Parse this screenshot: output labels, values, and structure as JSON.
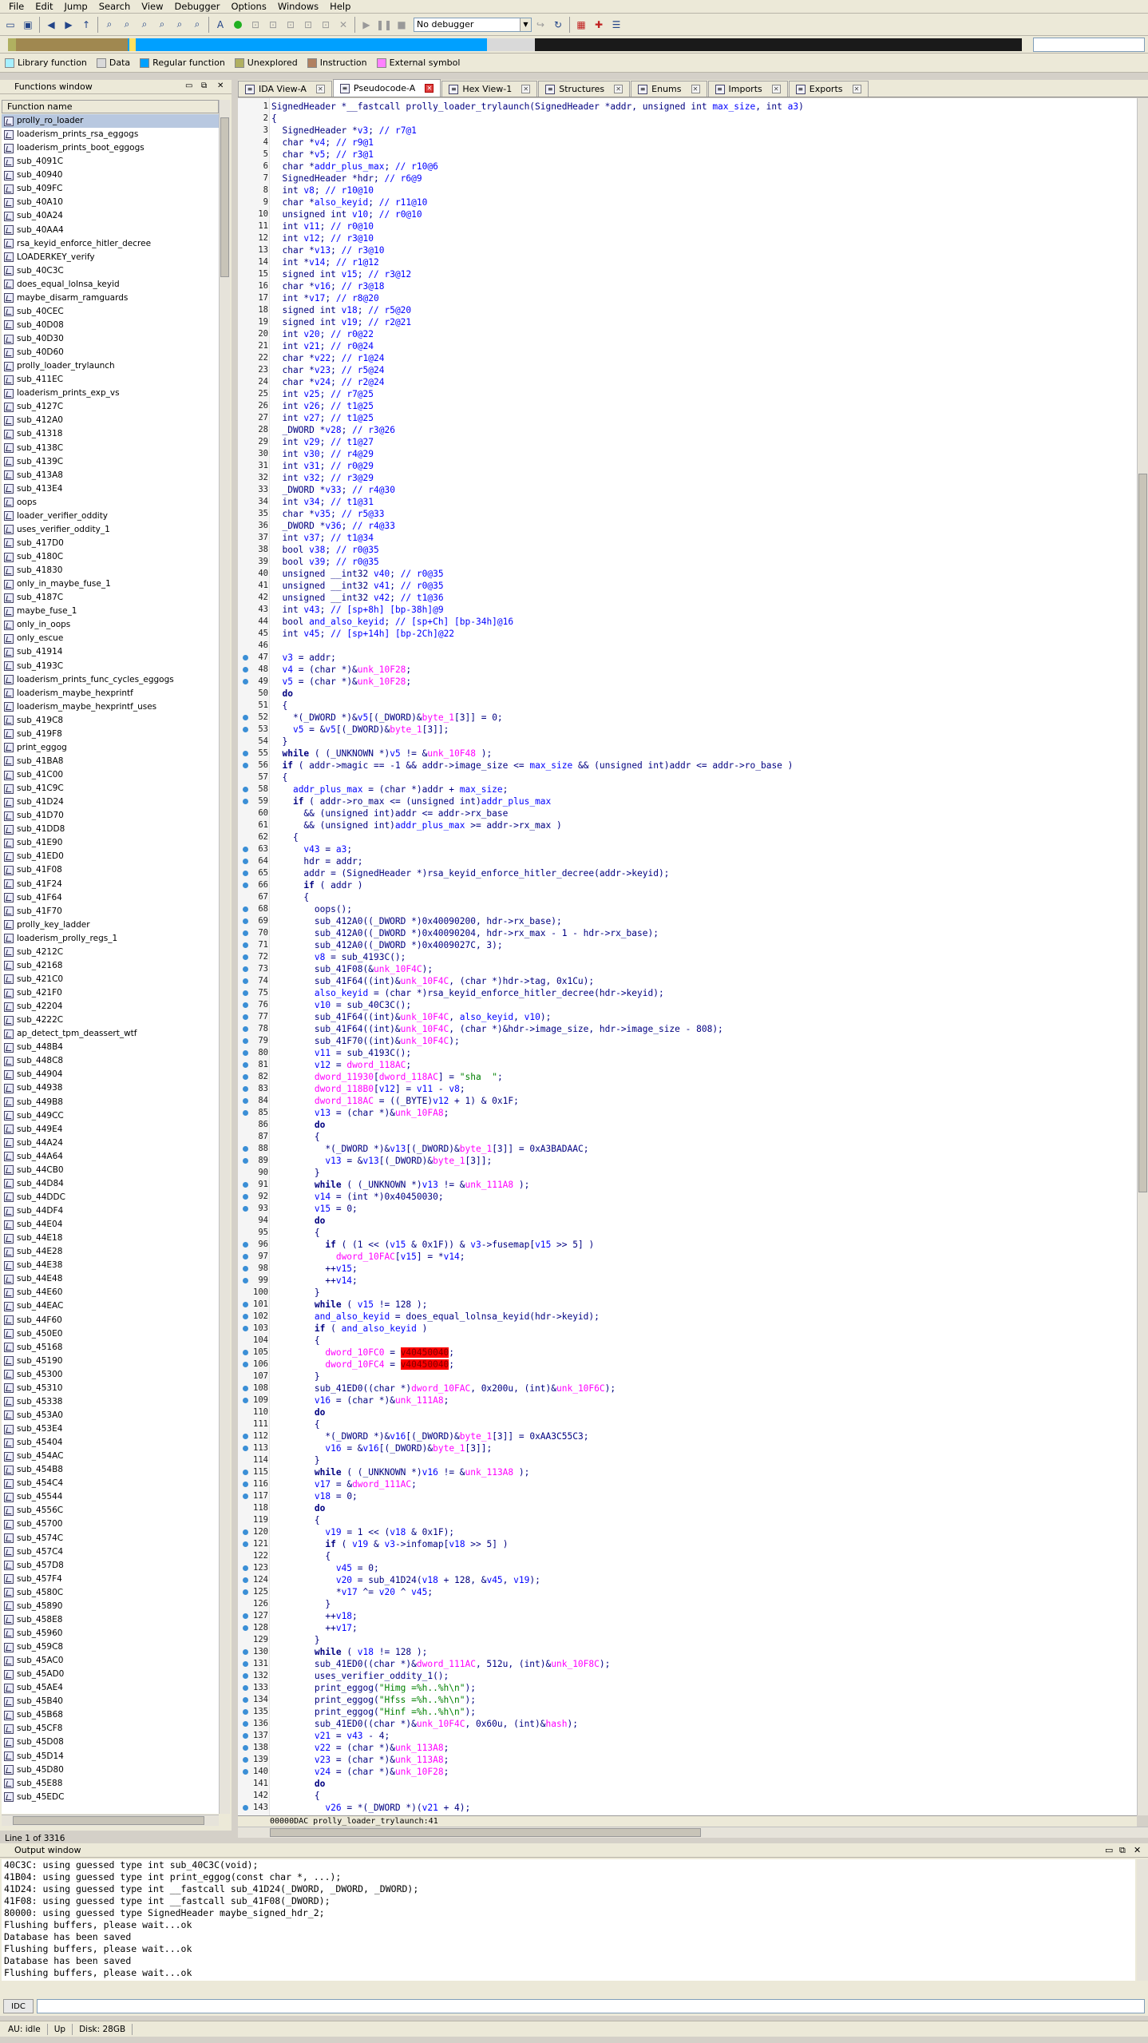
{
  "menu": [
    "File",
    "Edit",
    "Jump",
    "Search",
    "View",
    "Debugger",
    "Options",
    "Windows",
    "Help"
  ],
  "toolbar": {
    "debugger_select": "No debugger"
  },
  "legend": [
    {
      "label": "Library function",
      "color": "#a6f0ff"
    },
    {
      "label": "Data",
      "color": "#d9d9d9"
    },
    {
      "label": "Regular function",
      "color": "#00a0ff"
    },
    {
      "label": "Unexplored",
      "color": "#b0b060"
    },
    {
      "label": "Instruction",
      "color": "#b08060"
    },
    {
      "label": "External symbol",
      "color": "#ff80ff"
    }
  ],
  "functions_window": {
    "title": "Functions window",
    "column": "Function name",
    "status": "Line 1 of 3316",
    "items": [
      "prolly_ro_loader",
      "loaderism_prints_rsa_eggogs",
      "loaderism_prints_boot_eggogs",
      "sub_4091C",
      "sub_40940",
      "sub_409FC",
      "sub_40A10",
      "sub_40A24",
      "sub_40AA4",
      "rsa_keyid_enforce_hitler_decree",
      "LOADERKEY_verify",
      "sub_40C3C",
      "does_equal_lolnsa_keyid",
      "maybe_disarm_ramguards",
      "sub_40CEC",
      "sub_40D08",
      "sub_40D30",
      "sub_40D60",
      "prolly_loader_trylaunch",
      "sub_411EC",
      "loaderism_prints_exp_vs",
      "sub_4127C",
      "sub_412A0",
      "sub_41318",
      "sub_4138C",
      "sub_4139C",
      "sub_413A8",
      "sub_413E4",
      "oops",
      "loader_verifier_oddity",
      "uses_verifier_oddity_1",
      "sub_417D0",
      "sub_4180C",
      "sub_41830",
      "only_in_maybe_fuse_1",
      "sub_4187C",
      "maybe_fuse_1",
      "only_in_oops",
      "only_escue",
      "sub_41914",
      "sub_4193C",
      "loaderism_prints_func_cycles_eggogs",
      "loaderism_maybe_hexprintf",
      "loaderism_maybe_hexprintf_uses",
      "sub_419C8",
      "sub_419F8",
      "print_eggog",
      "sub_41BA8",
      "sub_41C00",
      "sub_41C9C",
      "sub_41D24",
      "sub_41D70",
      "sub_41DD8",
      "sub_41E90",
      "sub_41ED0",
      "sub_41F08",
      "sub_41F24",
      "sub_41F64",
      "sub_41F70",
      "prolly_key_ladder",
      "loaderism_prolly_regs_1",
      "sub_4212C",
      "sub_42168",
      "sub_421C0",
      "sub_421F0",
      "sub_42204",
      "sub_4222C",
      "ap_detect_tpm_deassert_wtf",
      "sub_448B4",
      "sub_448C8",
      "sub_44904",
      "sub_44938",
      "sub_449B8",
      "sub_449CC",
      "sub_449E4",
      "sub_44A24",
      "sub_44A64",
      "sub_44CB0",
      "sub_44D84",
      "sub_44DDC",
      "sub_44DF4",
      "sub_44E04",
      "sub_44E18",
      "sub_44E28",
      "sub_44E38",
      "sub_44E48",
      "sub_44E60",
      "sub_44EAC",
      "sub_44F60",
      "sub_450E0",
      "sub_45168",
      "sub_45190",
      "sub_45300",
      "sub_45310",
      "sub_45338",
      "sub_453A0",
      "sub_453E4",
      "sub_45404",
      "sub_454AC",
      "sub_454B8",
      "sub_454C4",
      "sub_45544",
      "sub_4556C",
      "sub_45700",
      "sub_4574C",
      "sub_457C4",
      "sub_457D8",
      "sub_457F4",
      "sub_4580C",
      "sub_45890",
      "sub_458E8",
      "sub_45960",
      "sub_459C8",
      "sub_45AC0",
      "sub_45AD0",
      "sub_45AE4",
      "sub_45B40",
      "sub_45B68",
      "sub_45CF8",
      "sub_45D08",
      "sub_45D14",
      "sub_45D80",
      "sub_45E88",
      "sub_45EDC"
    ]
  },
  "tabs": [
    {
      "label": "IDA View-A",
      "close": "plain"
    },
    {
      "label": "Pseudocode-A",
      "close": "red",
      "active": true
    },
    {
      "label": "Hex View-1",
      "close": "plain"
    },
    {
      "label": "Structures",
      "close": "plain"
    },
    {
      "label": "Enums",
      "close": "plain"
    },
    {
      "label": "Imports",
      "close": "plain"
    },
    {
      "label": "Exports",
      "close": "plain"
    }
  ],
  "code": {
    "lines": [
      {
        "n": "1",
        "dot": false,
        "t": "SignedHeader *__fastcall prolly_loader_trylaunch(SignedHeader *addr, unsigned int max_size, int a3)"
      },
      {
        "n": "2",
        "dot": false,
        "t": "{"
      },
      {
        "n": "3",
        "dot": false,
        "t": "  SignedHeader *v3; // r7@1"
      },
      {
        "n": "4",
        "dot": false,
        "t": "  char *v4; // r9@1"
      },
      {
        "n": "5",
        "dot": false,
        "t": "  char *v5; // r3@1"
      },
      {
        "n": "6",
        "dot": false,
        "t": "  char *addr_plus_max; // r10@6"
      },
      {
        "n": "7",
        "dot": false,
        "t": "  SignedHeader *hdr; // r6@9"
      },
      {
        "n": "8",
        "dot": false,
        "t": "  int v8; // r10@10"
      },
      {
        "n": "9",
        "dot": false,
        "t": "  char *also_keyid; // r11@10"
      },
      {
        "n": "10",
        "dot": false,
        "t": "  unsigned int v10; // r0@10"
      },
      {
        "n": "11",
        "dot": false,
        "t": "  int v11; // r0@10"
      },
      {
        "n": "12",
        "dot": false,
        "t": "  int v12; // r3@10"
      },
      {
        "n": "13",
        "dot": false,
        "t": "  char *v13; // r3@10"
      },
      {
        "n": "14",
        "dot": false,
        "t": "  int *v14; // r1@12"
      },
      {
        "n": "15",
        "dot": false,
        "t": "  signed int v15; // r3@12"
      },
      {
        "n": "16",
        "dot": false,
        "t": "  char *v16; // r3@18"
      },
      {
        "n": "17",
        "dot": false,
        "t": "  int *v17; // r8@20"
      },
      {
        "n": "18",
        "dot": false,
        "t": "  signed int v18; // r5@20"
      },
      {
        "n": "19",
        "dot": false,
        "t": "  signed int v19; // r2@21"
      },
      {
        "n": "20",
        "dot": false,
        "t": "  int v20; // r0@22"
      },
      {
        "n": "21",
        "dot": false,
        "t": "  int v21; // r0@24"
      },
      {
        "n": "22",
        "dot": false,
        "t": "  char *v22; // r1@24"
      },
      {
        "n": "23",
        "dot": false,
        "t": "  char *v23; // r5@24"
      },
      {
        "n": "24",
        "dot": false,
        "t": "  char *v24; // r2@24"
      },
      {
        "n": "25",
        "dot": false,
        "t": "  int v25; // r7@25"
      },
      {
        "n": "26",
        "dot": false,
        "t": "  int v26; // t1@25"
      },
      {
        "n": "27",
        "dot": false,
        "t": "  int v27; // t1@25"
      },
      {
        "n": "28",
        "dot": false,
        "t": "  _DWORD *v28; // r3@26"
      },
      {
        "n": "29",
        "dot": false,
        "t": "  int v29; // t1@27"
      },
      {
        "n": "30",
        "dot": false,
        "t": "  int v30; // r4@29"
      },
      {
        "n": "31",
        "dot": false,
        "t": "  int v31; // r0@29"
      },
      {
        "n": "32",
        "dot": false,
        "t": "  int v32; // r3@29"
      },
      {
        "n": "33",
        "dot": false,
        "t": "  _DWORD *v33; // r4@30"
      },
      {
        "n": "34",
        "dot": false,
        "t": "  int v34; // t1@31"
      },
      {
        "n": "35",
        "dot": false,
        "t": "  char *v35; // r5@33"
      },
      {
        "n": "36",
        "dot": false,
        "t": "  _DWORD *v36; // r4@33"
      },
      {
        "n": "37",
        "dot": false,
        "t": "  int v37; // t1@34"
      },
      {
        "n": "38",
        "dot": false,
        "t": "  bool v38; // r0@35"
      },
      {
        "n": "39",
        "dot": false,
        "t": "  bool v39; // r0@35"
      },
      {
        "n": "40",
        "dot": false,
        "t": "  unsigned __int32 v40; // r0@35"
      },
      {
        "n": "41",
        "dot": false,
        "t": "  unsigned __int32 v41; // r0@35"
      },
      {
        "n": "42",
        "dot": false,
        "t": "  unsigned __int32 v42; // t1@36"
      },
      {
        "n": "43",
        "dot": false,
        "t": "  int v43; // [sp+8h] [bp-38h]@9"
      },
      {
        "n": "44",
        "dot": false,
        "t": "  bool and_also_keyid; // [sp+Ch] [bp-34h]@16"
      },
      {
        "n": "45",
        "dot": false,
        "t": "  int v45; // [sp+14h] [bp-2Ch]@22"
      },
      {
        "n": "46",
        "dot": false,
        "t": ""
      },
      {
        "n": "47",
        "dot": true,
        "t": "  v3 = addr;"
      },
      {
        "n": "48",
        "dot": true,
        "t": "  v4 = (char *)&unk_10F28;"
      },
      {
        "n": "49",
        "dot": true,
        "t": "  v5 = (char *)&unk_10F28;"
      },
      {
        "n": "50",
        "dot": false,
        "t": "  do"
      },
      {
        "n": "51",
        "dot": false,
        "t": "  {"
      },
      {
        "n": "52",
        "dot": true,
        "t": "    *(_DWORD *)&v5[(_DWORD)&byte_1[3]] = 0;"
      },
      {
        "n": "53",
        "dot": true,
        "t": "    v5 = &v5[(_DWORD)&byte_1[3]];"
      },
      {
        "n": "54",
        "dot": false,
        "t": "  }"
      },
      {
        "n": "55",
        "dot": true,
        "t": "  while ( (_UNKNOWN *)v5 != &unk_10F48 );"
      },
      {
        "n": "56",
        "dot": true,
        "t": "  if ( addr->magic == -1 && addr->image_size <= max_size && (unsigned int)addr <= addr->ro_base )"
      },
      {
        "n": "57",
        "dot": false,
        "t": "  {"
      },
      {
        "n": "58",
        "dot": true,
        "t": "    addr_plus_max = (char *)addr + max_size;"
      },
      {
        "n": "59",
        "dot": true,
        "t": "    if ( addr->ro_max <= (unsigned int)addr_plus_max"
      },
      {
        "n": "60",
        "dot": false,
        "t": "      && (unsigned int)addr <= addr->rx_base"
      },
      {
        "n": "61",
        "dot": false,
        "t": "      && (unsigned int)addr_plus_max >= addr->rx_max )"
      },
      {
        "n": "62",
        "dot": false,
        "t": "    {"
      },
      {
        "n": "63",
        "dot": true,
        "t": "      v43 = a3;"
      },
      {
        "n": "64",
        "dot": true,
        "t": "      hdr = addr;"
      },
      {
        "n": "65",
        "dot": true,
        "t": "      addr = (SignedHeader *)rsa_keyid_enforce_hitler_decree(addr->keyid);"
      },
      {
        "n": "66",
        "dot": true,
        "t": "      if ( addr )"
      },
      {
        "n": "67",
        "dot": false,
        "t": "      {"
      },
      {
        "n": "68",
        "dot": true,
        "t": "        oops();"
      },
      {
        "n": "69",
        "dot": true,
        "t": "        sub_412A0((_DWORD *)0x40090200, hdr->rx_base);"
      },
      {
        "n": "70",
        "dot": true,
        "t": "        sub_412A0((_DWORD *)0x40090204, hdr->rx_max - 1 - hdr->rx_base);"
      },
      {
        "n": "71",
        "dot": true,
        "t": "        sub_412A0((_DWORD *)0x4009027C, 3);"
      },
      {
        "n": "72",
        "dot": true,
        "t": "        v8 = sub_4193C();"
      },
      {
        "n": "73",
        "dot": true,
        "t": "        sub_41F08(&unk_10F4C);"
      },
      {
        "n": "74",
        "dot": true,
        "t": "        sub_41F64((int)&unk_10F4C, (char *)hdr->tag, 0x1Cu);"
      },
      {
        "n": "75",
        "dot": true,
        "t": "        also_keyid = (char *)rsa_keyid_enforce_hitler_decree(hdr->keyid);"
      },
      {
        "n": "76",
        "dot": true,
        "t": "        v10 = sub_40C3C();"
      },
      {
        "n": "77",
        "dot": true,
        "t": "        sub_41F64((int)&unk_10F4C, also_keyid, v10);"
      },
      {
        "n": "78",
        "dot": true,
        "t": "        sub_41F64((int)&unk_10F4C, (char *)&hdr->image_size, hdr->image_size - 808);"
      },
      {
        "n": "79",
        "dot": true,
        "t": "        sub_41F70((int)&unk_10F4C);"
      },
      {
        "n": "80",
        "dot": true,
        "t": "        v11 = sub_4193C();"
      },
      {
        "n": "81",
        "dot": true,
        "t": "        v12 = dword_118AC;"
      },
      {
        "n": "82",
        "dot": true,
        "t": "        dword_11930[dword_118AC] = \"sha  \";"
      },
      {
        "n": "83",
        "dot": true,
        "t": "        dword_118B0[v12] = v11 - v8;"
      },
      {
        "n": "84",
        "dot": true,
        "t": "        dword_118AC = ((_BYTE)v12 + 1) & 0x1F;"
      },
      {
        "n": "85",
        "dot": true,
        "t": "        v13 = (char *)&unk_10FA8;"
      },
      {
        "n": "86",
        "dot": false,
        "t": "        do"
      },
      {
        "n": "87",
        "dot": false,
        "t": "        {"
      },
      {
        "n": "88",
        "dot": true,
        "t": "          *(_DWORD *)&v13[(_DWORD)&byte_1[3]] = 0xA3BADAAC;"
      },
      {
        "n": "89",
        "dot": true,
        "t": "          v13 = &v13[(_DWORD)&byte_1[3]];"
      },
      {
        "n": "90",
        "dot": false,
        "t": "        }"
      },
      {
        "n": "91",
        "dot": true,
        "t": "        while ( (_UNKNOWN *)v13 != &unk_111A8 );"
      },
      {
        "n": "92",
        "dot": true,
        "t": "        v14 = (int *)0x40450030;"
      },
      {
        "n": "93",
        "dot": true,
        "t": "        v15 = 0;"
      },
      {
        "n": "94",
        "dot": false,
        "t": "        do"
      },
      {
        "n": "95",
        "dot": false,
        "t": "        {"
      },
      {
        "n": "96",
        "dot": true,
        "t": "          if ( (1 << (v15 & 0x1F)) & v3->fusemap[v15 >> 5] )"
      },
      {
        "n": "97",
        "dot": true,
        "t": "            dword_10FAC[v15] = *v14;"
      },
      {
        "n": "98",
        "dot": true,
        "t": "          ++v15;"
      },
      {
        "n": "99",
        "dot": true,
        "t": "          ++v14;"
      },
      {
        "n": "100",
        "dot": false,
        "t": "        }"
      },
      {
        "n": "101",
        "dot": true,
        "t": "        while ( v15 != 128 );"
      },
      {
        "n": "102",
        "dot": true,
        "t": "        and_also_keyid = does_equal_lolnsa_keyid(hdr->keyid);"
      },
      {
        "n": "103",
        "dot": true,
        "t": "        if ( and_also_keyid )"
      },
      {
        "n": "104",
        "dot": false,
        "t": "        {"
      },
      {
        "n": "105",
        "dot": true,
        "t": "          dword_10FC0 = v40450040;"
      },
      {
        "n": "106",
        "dot": true,
        "t": "          dword_10FC4 = v40450040;"
      },
      {
        "n": "107",
        "dot": false,
        "t": "        }"
      },
      {
        "n": "108",
        "dot": true,
        "t": "        sub_41ED0((char *)dword_10FAC, 0x200u, (int)&unk_10F6C);"
      },
      {
        "n": "109",
        "dot": true,
        "t": "        v16 = (char *)&unk_111A8;"
      },
      {
        "n": "110",
        "dot": false,
        "t": "        do"
      },
      {
        "n": "111",
        "dot": false,
        "t": "        {"
      },
      {
        "n": "112",
        "dot": true,
        "t": "          *(_DWORD *)&v16[(_DWORD)&byte_1[3]] = 0xAA3C55C3;"
      },
      {
        "n": "113",
        "dot": true,
        "t": "          v16 = &v16[(_DWORD)&byte_1[3]];"
      },
      {
        "n": "114",
        "dot": false,
        "t": "        }"
      },
      {
        "n": "115",
        "dot": true,
        "t": "        while ( (_UNKNOWN *)v16 != &unk_113A8 );"
      },
      {
        "n": "116",
        "dot": true,
        "t": "        v17 = &dword_111AC;"
      },
      {
        "n": "117",
        "dot": true,
        "t": "        v18 = 0;"
      },
      {
        "n": "118",
        "dot": false,
        "t": "        do"
      },
      {
        "n": "119",
        "dot": false,
        "t": "        {"
      },
      {
        "n": "120",
        "dot": true,
        "t": "          v19 = 1 << (v18 & 0x1F);"
      },
      {
        "n": "121",
        "dot": true,
        "t": "          if ( v19 & v3->infomap[v18 >> 5] )"
      },
      {
        "n": "122",
        "dot": false,
        "t": "          {"
      },
      {
        "n": "123",
        "dot": true,
        "t": "            v45 = 0;"
      },
      {
        "n": "124",
        "dot": true,
        "t": "            v20 = sub_41D24(v18 + 128, &v45, v19);"
      },
      {
        "n": "125",
        "dot": true,
        "t": "            *v17 ^= v20 ^ v45;"
      },
      {
        "n": "126",
        "dot": false,
        "t": "          }"
      },
      {
        "n": "127",
        "dot": true,
        "t": "          ++v18;"
      },
      {
        "n": "128",
        "dot": true,
        "t": "          ++v17;"
      },
      {
        "n": "129",
        "dot": false,
        "t": "        }"
      },
      {
        "n": "130",
        "dot": true,
        "t": "        while ( v18 != 128 );"
      },
      {
        "n": "131",
        "dot": true,
        "t": "        sub_41ED0((char *)&dword_111AC, 512u, (int)&unk_10F8C);"
      },
      {
        "n": "132",
        "dot": true,
        "t": "        uses_verifier_oddity_1();"
      },
      {
        "n": "133",
        "dot": true,
        "t": "        print_eggog(\"Himg =%h..%h\\n\");"
      },
      {
        "n": "134",
        "dot": true,
        "t": "        print_eggog(\"Hfss =%h..%h\\n\");"
      },
      {
        "n": "135",
        "dot": true,
        "t": "        print_eggog(\"Hinf =%h..%h\\n\");"
      },
      {
        "n": "136",
        "dot": true,
        "t": "        sub_41ED0((char *)&unk_10F4C, 0x60u, (int)&hash);"
      },
      {
        "n": "137",
        "dot": true,
        "t": "        v21 = v43 - 4;"
      },
      {
        "n": "138",
        "dot": true,
        "t": "        v22 = (char *)&unk_113A8;"
      },
      {
        "n": "139",
        "dot": true,
        "t": "        v23 = (char *)&unk_113A8;"
      },
      {
        "n": "140",
        "dot": true,
        "t": "        v24 = (char *)&unk_10F28;"
      },
      {
        "n": "141",
        "dot": false,
        "t": "        do"
      },
      {
        "n": "142",
        "dot": false,
        "t": "        {"
      },
      {
        "n": "143",
        "dot": true,
        "t": "          v26 = *(_DWORD *)(v21 + 4);"
      }
    ],
    "addr_bar": "00000DAC prolly_loader_trylaunch:41"
  },
  "output_window": {
    "title": "Output window",
    "lines": [
      "40C3C: using guessed type int sub_40C3C(void);",
      "41B04: using guessed type int print_eggog(const char *, ...);",
      "41D24: using guessed type int __fastcall sub_41D24(_DWORD, _DWORD, _DWORD);",
      "41F08: using guessed type int __fastcall sub_41F08(_DWORD);",
      "80000: using guessed type SignedHeader maybe_signed_hdr_2;",
      "Flushing buffers, please wait...ok",
      "Database has been saved",
      "Flushing buffers, please wait...ok",
      "Database has been saved",
      "Flushing buffers, please wait...ok",
      "Database has been saved"
    ]
  },
  "idc": {
    "label": "IDC"
  },
  "status": {
    "au": "AU:  idle",
    "dir": "Up",
    "disk": "Disk: 28GB"
  }
}
